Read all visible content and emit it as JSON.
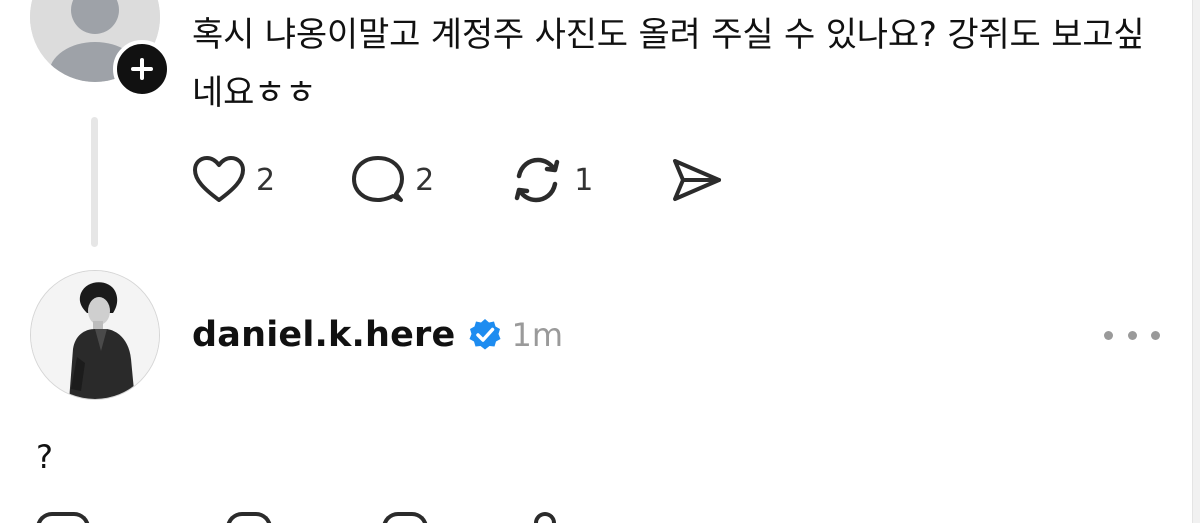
{
  "reply_post": {
    "text": "혹시 냐옹이말고 계정주 사진도 올려 주실 수 있나요? 강쥐도 보고싶네요ㅎㅎ",
    "likes": "2",
    "comments": "2",
    "reposts": "1",
    "avatar_icon": "user-placeholder-icon",
    "follow_icon": "plus-icon"
  },
  "post": {
    "username": "daniel.k.here",
    "verified_icon": "verified-badge-icon",
    "time": "1m",
    "body": "?",
    "more_icon": "more-dots-icon"
  },
  "colors": {
    "verified_blue": "#1d8cf0",
    "thread_line": "#e6e6e6",
    "muted_text": "#9a9a9a",
    "text": "#111111"
  }
}
